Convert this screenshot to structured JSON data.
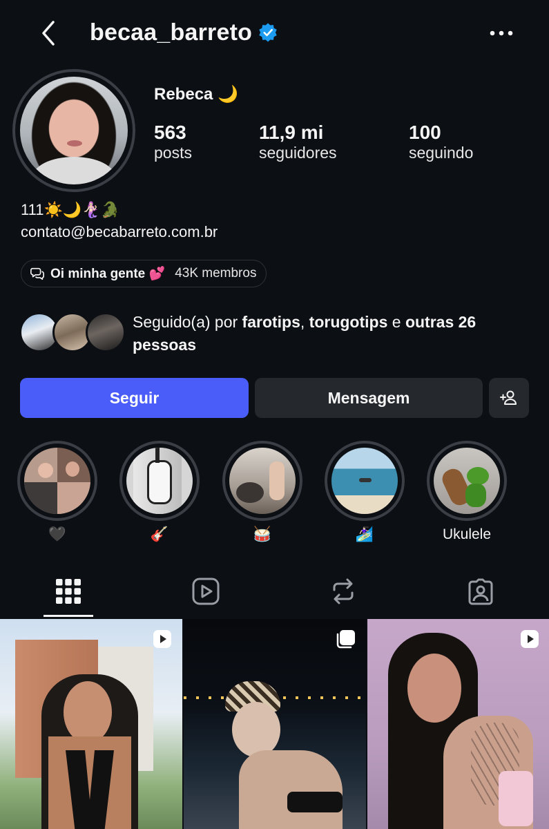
{
  "header": {
    "username": "becaa_barreto",
    "icons": [
      "chevron-left-icon",
      "verified-badge-icon",
      "more-horizontal-icon"
    ],
    "accent": "#1d9bf0"
  },
  "profile": {
    "display_name": "Rebeca 🌙",
    "stats": [
      {
        "value": "563",
        "label": "posts"
      },
      {
        "value": "11,9 mi",
        "label": "seguidores"
      },
      {
        "value": "100",
        "label": "seguindo"
      }
    ],
    "bio_line1": "111☀️🌙🧜🏻‍♀️🐊",
    "bio_line2": "contato@becabarreto.com.br"
  },
  "community": {
    "name": "Oi minha gente 💕",
    "members": "43K membros",
    "icon": "chat-bubbles-icon"
  },
  "followed_by": {
    "prefix": "Seguido(a) por ",
    "user1": "farotips",
    "sep": ", ",
    "user2": "torugotips",
    "conj": " e ",
    "others": "outras 26 pessoas"
  },
  "actions": {
    "follow": "Seguir",
    "message": "Mensagem",
    "add_icon": "add-person-icon",
    "follow_color": "#4a5df9"
  },
  "highlights": [
    {
      "label": "🖤"
    },
    {
      "label": "🎸"
    },
    {
      "label": "🥁"
    },
    {
      "label": "🏄🏻‍♀️"
    },
    {
      "label": "Ukulele"
    }
  ],
  "tabs": [
    "grid-icon",
    "reels-icon",
    "reposts-icon",
    "tagged-icon"
  ],
  "posts": [
    {
      "badge": "reel-icon"
    },
    {
      "badge": "carousel-icon"
    },
    {
      "badge": "reel-icon"
    }
  ]
}
